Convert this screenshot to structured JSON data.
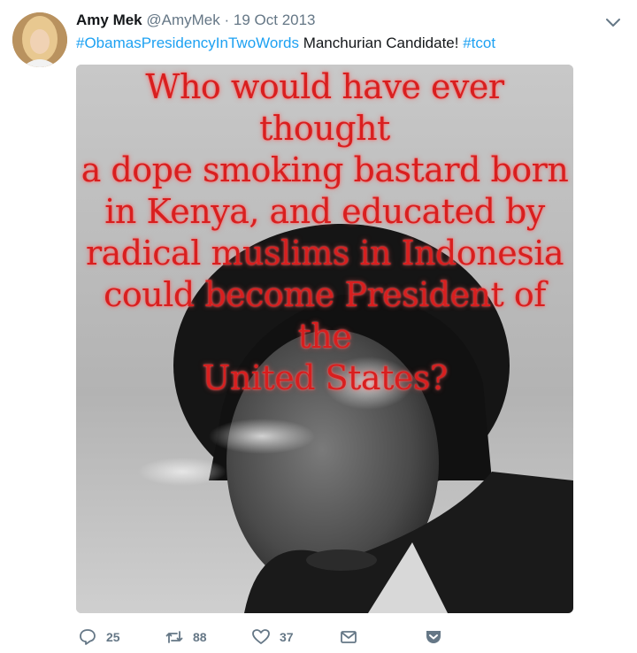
{
  "tweet": {
    "author_name": "Amy Mek",
    "handle": "@AmyMek",
    "separator": "·",
    "date": "19 Oct 2013",
    "text": {
      "hashtag1": "#ObamasPresidencyInTwoWords",
      "body": " Manchurian Candidate! ",
      "hashtag2": "#tcot"
    },
    "image_text": "Who would have ever thought a dope smoking bastard born in Kenya, and educated by radical muslims in Indonesia could become President of the United States?",
    "image_lines": [
      "Who would have ever thought",
      "a dope smoking bastard born",
      "in Kenya, and educated by",
      "radical muslims in Indonesia",
      "could become President of the",
      "United States?"
    ]
  },
  "actions": {
    "reply_count": "25",
    "retweet_count": "88",
    "like_count": "37"
  },
  "colors": {
    "link": "#1da1f2",
    "muted": "#657786",
    "overlay_text": "#d81f1f"
  },
  "icons": [
    "chevron-down-icon",
    "reply-icon",
    "retweet-icon",
    "like-icon",
    "message-icon",
    "pocket-icon"
  ]
}
